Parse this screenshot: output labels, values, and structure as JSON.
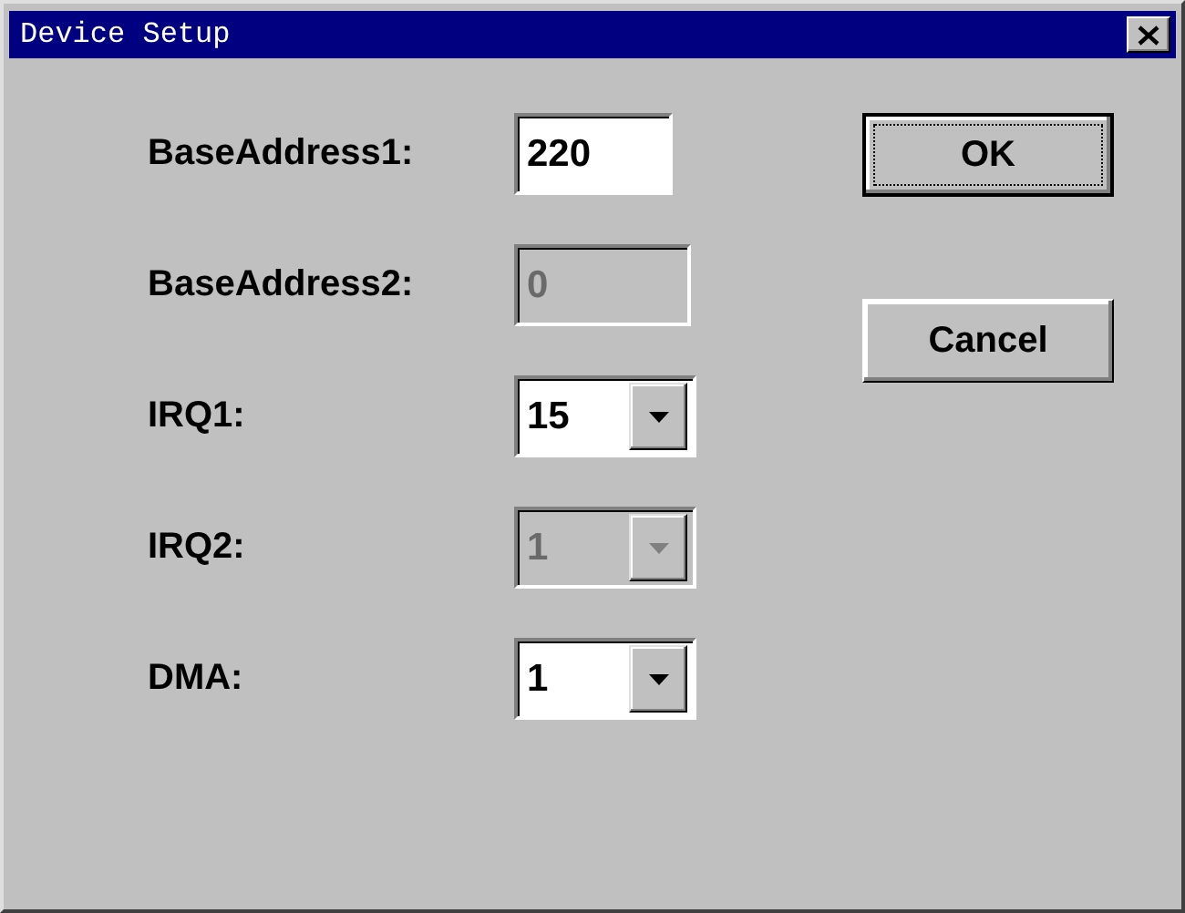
{
  "window": {
    "title": "Device Setup"
  },
  "fields": [
    {
      "label": "BaseAddress1:",
      "kind": "text",
      "value": "220",
      "disabled": false
    },
    {
      "label": "BaseAddress2:",
      "kind": "text",
      "value": "0",
      "disabled": true
    },
    {
      "label": "IRQ1:",
      "kind": "combo",
      "value": "15",
      "disabled": false
    },
    {
      "label": "IRQ2:",
      "kind": "combo",
      "value": "1",
      "disabled": true
    },
    {
      "label": "DMA:",
      "kind": "combo",
      "value": "1",
      "disabled": false
    }
  ],
  "buttons": [
    {
      "label": "OK",
      "default": true
    },
    {
      "label": "Cancel",
      "default": false
    }
  ]
}
